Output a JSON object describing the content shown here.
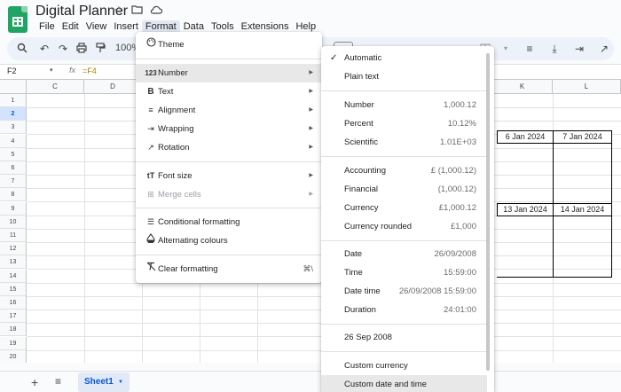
{
  "app": {
    "doc_title": "Digital Planner",
    "menus": [
      "File",
      "Edit",
      "View",
      "Insert",
      "Format",
      "Data",
      "Tools",
      "Extensions",
      "Help"
    ],
    "active_menu": "Format"
  },
  "toolbar": {
    "zoom": "100%"
  },
  "formula_bar": {
    "cell_ref": "F2",
    "formula": "=F4"
  },
  "grid": {
    "columns": [
      "C",
      "D",
      "",
      "",
      "",
      "",
      "",
      "",
      "K",
      "L"
    ],
    "rows": [
      "1",
      "2",
      "3",
      "4",
      "5",
      "6",
      "7",
      "8",
      "9",
      "10",
      "11",
      "12",
      "13",
      "14",
      "15",
      "16",
      "17",
      "18",
      "19",
      "20"
    ],
    "selected_row": "2",
    "dates": [
      "6 Jan 2024",
      "7 Jan 2024",
      "13 Jan 2024",
      "14 Jan 2024"
    ]
  },
  "sheets": {
    "active": "Sheet1"
  },
  "format_menu": {
    "items": [
      {
        "icon": "palette-icon",
        "label": "Theme"
      },
      {
        "icon": "number-icon",
        "glyph": "123",
        "label": "Number",
        "submenu": true,
        "highlighted": true
      },
      {
        "icon": "bold-icon",
        "glyph": "B",
        "label": "Text",
        "submenu": true
      },
      {
        "icon": "align-icon",
        "label": "Alignment",
        "submenu": true
      },
      {
        "icon": "wrap-icon",
        "label": "Wrapping",
        "submenu": true
      },
      {
        "icon": "rotation-icon",
        "label": "Rotation",
        "submenu": true
      },
      {
        "icon": "font-size-icon",
        "glyph": "tT",
        "label": "Font size",
        "submenu": true
      },
      {
        "icon": "merge-icon",
        "label": "Merge cells",
        "submenu": true,
        "disabled": true
      },
      {
        "icon": "conditional-format-icon",
        "label": "Conditional formatting"
      },
      {
        "icon": "alternating-colours-icon",
        "label": "Alternating colours"
      },
      {
        "icon": "clear-format-icon",
        "label": "Clear formatting",
        "shortcut": "⌘\\"
      }
    ]
  },
  "number_menu": {
    "items": [
      {
        "label": "Automatic",
        "example": "",
        "checked": true
      },
      {
        "label": "Plain text",
        "example": ""
      },
      {
        "label": "Number",
        "example": "1,000.12"
      },
      {
        "label": "Percent",
        "example": "10.12%"
      },
      {
        "label": "Scientific",
        "example": "1.01E+03"
      },
      {
        "label": "Accounting",
        "example": "£ (1,000.12)"
      },
      {
        "label": "Financial",
        "example": "(1,000.12)"
      },
      {
        "label": "Currency",
        "example": "£1,000.12"
      },
      {
        "label": "Currency rounded",
        "example": "£1,000"
      },
      {
        "label": "Date",
        "example": "26/09/2008"
      },
      {
        "label": "Time",
        "example": "15:59:00"
      },
      {
        "label": "Date time",
        "example": "26/09/2008 15:59:00"
      },
      {
        "label": "Duration",
        "example": "24:01:00"
      },
      {
        "label": "26 Sep 2008",
        "example": ""
      },
      {
        "label": "Custom currency",
        "example": ""
      },
      {
        "label": "Custom date and time",
        "example": ""
      }
    ]
  },
  "colors": {
    "accent": "#0b57d0",
    "brand": "#1fa463"
  }
}
